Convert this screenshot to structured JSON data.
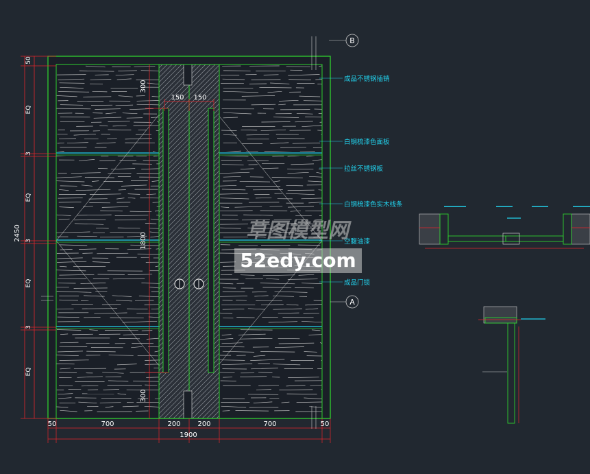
{
  "colors": {
    "background": "#212830",
    "panel": "#1a1f27",
    "green": "#2fd12f",
    "grain": "#d4d4d4",
    "cyan": "#22d3ee",
    "red": "#e5262b",
    "white": "#ffffff",
    "hatch": "#9aa0a6"
  },
  "elevation": {
    "overall_height": "2450",
    "overall_width": "1900",
    "left_dims": [
      "50",
      "EQ",
      "3",
      "EQ",
      "3",
      "EQ",
      "3",
      "EQ"
    ],
    "bottom_dims": [
      "50",
      "700",
      "200",
      "200",
      "700",
      "50"
    ],
    "top_dims": [
      "150",
      "150"
    ],
    "center_dims": [
      "300",
      "1800",
      "300"
    ],
    "annotations": [
      "成品不锈钢插销",
      "白钢梳漆色面板",
      "拉丝不锈钢板",
      "白钢梳漆色实木线条",
      "空腹油漆",
      "成品门锁"
    ],
    "grid_markers": [
      "B",
      "A"
    ]
  },
  "watermark": {
    "line1": "草图模型网",
    "line2": "52edy.com"
  }
}
